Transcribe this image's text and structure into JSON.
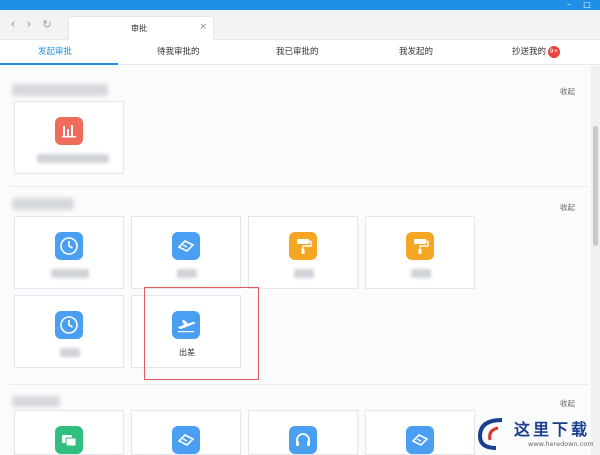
{
  "browser": {
    "tab_title": "审批",
    "tab_close": "×",
    "nav": {
      "back": "‹",
      "forward": "›",
      "reload": "↻"
    },
    "window_controls": [
      "–",
      "□"
    ]
  },
  "subtabs": [
    {
      "label": "发起审批",
      "active": true
    },
    {
      "label": "待我审批的",
      "active": false
    },
    {
      "label": "我已审批的",
      "active": false
    },
    {
      "label": "我发起的",
      "active": false
    },
    {
      "label": "抄送我的",
      "active": false,
      "badge": "9+"
    }
  ],
  "sections": [
    {
      "collapse_label": "收起"
    },
    {
      "collapse_label": "收起"
    },
    {
      "collapse_label": "收起"
    }
  ],
  "highlighted_card": {
    "label": "出差",
    "icon": "airplane-icon"
  },
  "icons": {
    "section1": [
      "bar-chart-icon"
    ],
    "section2": [
      "clock-icon",
      "handshake-icon",
      "paint-roller-icon",
      "paint-roller-icon",
      "clock-icon",
      "airplane-icon"
    ],
    "section3": [
      "chat-icon",
      "handshake-icon",
      "headset-icon",
      "handshake-icon"
    ]
  },
  "colors": {
    "accent": "#1f8fe6",
    "badge": "#e94040",
    "highlight_border": "#e05a5a"
  },
  "watermark": {
    "text": "这里下载",
    "url": "www.heredown.com"
  }
}
